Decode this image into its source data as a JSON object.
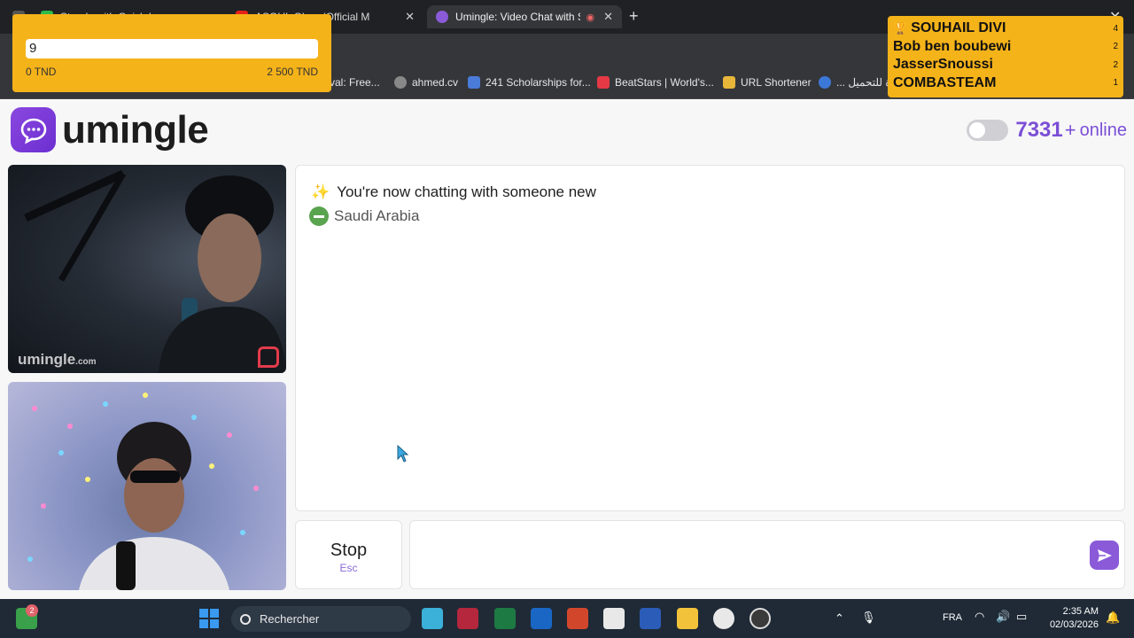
{
  "browser": {
    "tabs": [
      {
        "label": "",
        "active": false
      },
      {
        "label": "Stands with Quickdraw",
        "active": false
      },
      {
        "label": "ASOUL Glory (Official M",
        "active": false
      },
      {
        "label": "Umingle: Video Chat with St",
        "active": true
      }
    ],
    "bookmarks": [
      {
        "label": "val: Free..."
      },
      {
        "label": "ahmed.cv"
      },
      {
        "label": "241 Scholarships for..."
      },
      {
        "label": "BeatStars | World's..."
      },
      {
        "label": "URL Shortener"
      },
      {
        "label": "... ة للتحميل"
      }
    ]
  },
  "donation_widget": {
    "amount": "9",
    "min_label": "0 TND",
    "max_label": "2 500 TND",
    "accent": "#f5b31a"
  },
  "leaderboard": [
    {
      "name": "SOUHAIL DIVI",
      "count": "4",
      "icon": "trophy-icon"
    },
    {
      "name": "Bob ben boubewi",
      "count": "2"
    },
    {
      "name": "JasserSnoussi",
      "count": "2"
    },
    {
      "name": "COMBASTEAM",
      "count": "1"
    }
  ],
  "site": {
    "logo_text": "umingle",
    "brand_color": "#7b4fd6",
    "online_count": "7331",
    "online_plus": "+",
    "online_label": "online"
  },
  "video": {
    "watermark_main": "umingle",
    "watermark_suffix": ".com"
  },
  "chat": {
    "message": "You're now chatting with someone new",
    "country": "Saudi Arabia"
  },
  "controls": {
    "stop_label": "Stop",
    "stop_hint": "Esc",
    "message_placeholder": ""
  },
  "taskbar": {
    "search_label": "Rechercher",
    "notification_badge": "2",
    "language": "FRA",
    "time": "2:35 AM",
    "date": "02/03/2026"
  }
}
